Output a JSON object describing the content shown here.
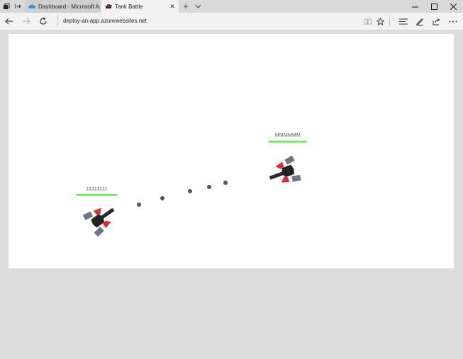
{
  "browser": {
    "tabs": [
      {
        "title": "Dashboard - Microsoft Azur",
        "active": false,
        "favicon": "cloud-icon"
      },
      {
        "title": "Tank Battle",
        "active": true,
        "favicon": "tank-icon"
      }
    ],
    "new_tab_symbol": "+",
    "tab_list_symbol": "⌄",
    "address": "deploy-an-app.azurewebsites.net",
    "nav_icons": [
      "back-arrow-icon",
      "forward-arrow-icon",
      "refresh-icon"
    ],
    "toolbar_icons": [
      "reading-view-icon",
      "favorite-star-icon",
      "hub-icon",
      "web-note-icon",
      "share-icon",
      "more-icon"
    ],
    "window_controls": [
      "minimize-icon",
      "maximize-icon",
      "close-icon"
    ]
  },
  "game": {
    "players": [
      {
        "name": "JJJJJJJJ",
        "health": 1.0,
        "health_color": "#5cf03c",
        "tank_accent": "#e8242a"
      },
      {
        "name": "MMMMMM",
        "health": 1.0,
        "health_color": "#5cf03c",
        "tank_accent": "#e8242a"
      }
    ],
    "projectiles": 5,
    "projectile_color": "#555555",
    "canvas_background": "#ffffff"
  }
}
